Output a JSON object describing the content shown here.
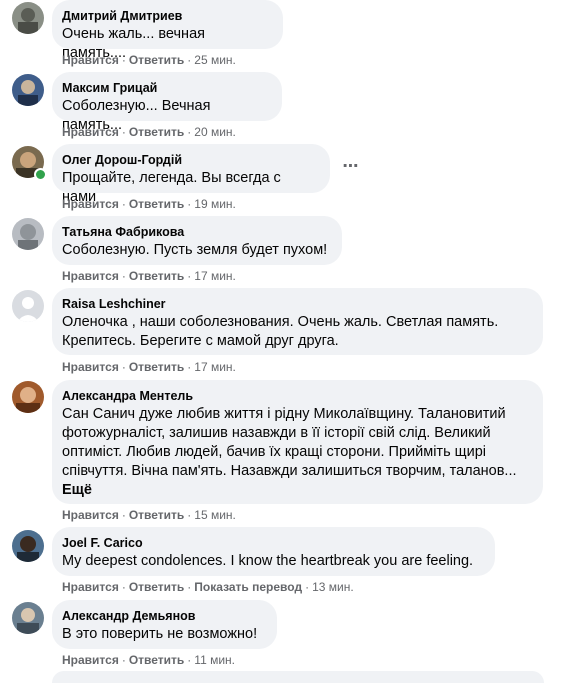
{
  "actions": {
    "like": "Нравится",
    "reply": "Ответить",
    "translate": "Показать перевод",
    "sep": "·"
  },
  "comments": [
    {
      "author": "Дмитрий Дмитриев",
      "text": "Очень жаль... вечная память....",
      "time": "25 мин."
    },
    {
      "author": "Максим Грицай",
      "text": "Соболезную... Вечная память...",
      "time": "20 мин."
    },
    {
      "author": "Олег Дорош-Гордій",
      "text": "Прощайте, легенда. Вы всегда с нами",
      "time": "19 мин.",
      "online": true
    },
    {
      "author": "Татьяна Фабрикова",
      "text": "Соболезную. Пусть земля будет пухом!",
      "time": "17 мин."
    },
    {
      "author": "Raisa Leshchiner",
      "text_lines": [
        "Оленочка , наши соболезнования. Очень жаль. Светлая память.",
        "Крепитесь. Берегите с мамой друг друга."
      ],
      "time": "17 мин."
    },
    {
      "author": "Александра Ментель",
      "text_lines": [
        "Сан Санич дуже любив життя і рідну Миколаївщину. Талановитий",
        "фотожурналіст, залишив назавжди в її історії свій слід. Великий",
        "оптиміст. Любив людей, бачив їх кращі сторони. Прийміть щирі",
        "співчуття. Вічна пам'ять. Назавжди залишиться творчим, таланов..."
      ],
      "more": "Ещё",
      "time": "15 мин."
    },
    {
      "author": "Joel F. Carico",
      "text": "My deepest condolences. I know the heartbreak you are feeling.",
      "time": "13 мин."
    },
    {
      "author": "Александр Демьянов",
      "text": "В это поверить не возможно!",
      "time": "11 мин."
    }
  ],
  "colors": {
    "bubble": "#f0f2f5",
    "meta_text": "#65676b",
    "online": "#31a24c"
  },
  "icons": {
    "more_options": "ellipsis-icon"
  }
}
